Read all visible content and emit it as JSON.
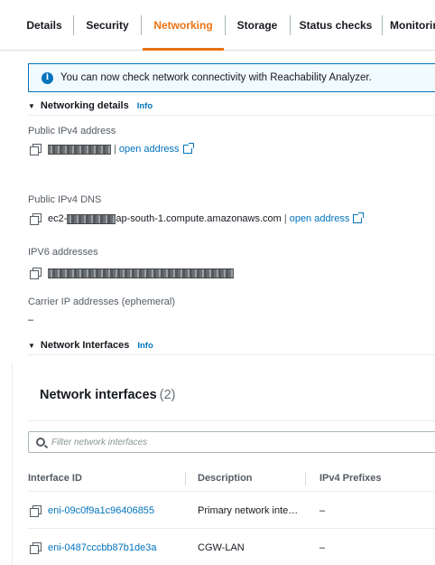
{
  "tabs": [
    {
      "label": "Details",
      "active": false
    },
    {
      "label": "Security",
      "active": false
    },
    {
      "label": "Networking",
      "active": true
    },
    {
      "label": "Storage",
      "active": false
    },
    {
      "label": "Status checks",
      "active": false
    },
    {
      "label": "Monitoring",
      "active": false
    }
  ],
  "alert": {
    "icon": "info-icon",
    "text": "You can now check network connectivity with Reachability Analyzer."
  },
  "networking_details": {
    "heading": "Networking details",
    "info_label": "Info",
    "public_ipv4": {
      "label": "Public IPv4 address",
      "separator": "|",
      "link_text": "open address"
    },
    "public_dns": {
      "label": "Public IPv4 DNS",
      "prefix": "ec2-",
      "suffix": "ap-south-1.compute.amazonaws.com",
      "separator": "|",
      "link_text": "open address"
    },
    "ipv6": {
      "label": "IPV6 addresses"
    },
    "carrier_ip": {
      "label": "Carrier IP addresses (ephemeral)",
      "value": "–"
    }
  },
  "network_interfaces_section": {
    "heading": "Network Interfaces",
    "info_label": "Info"
  },
  "interfaces_panel": {
    "title": "Network interfaces",
    "count": "(2)",
    "filter_placeholder": "Filter network interfaces",
    "columns": [
      "Interface ID",
      "Description",
      "IPv4 Prefixes"
    ],
    "rows": [
      {
        "interface_id": "eni-09c0f9a1c96406855",
        "description": "Primary network inte…",
        "ipv4_prefixes": "–"
      },
      {
        "interface_id": "eni-0487cccbb87b1de3a",
        "description": "CGW-LAN",
        "ipv4_prefixes": "–"
      }
    ]
  },
  "colors": {
    "accent": "#ec7211",
    "link": "#0073bb",
    "alert_bg": "#f1faff"
  }
}
